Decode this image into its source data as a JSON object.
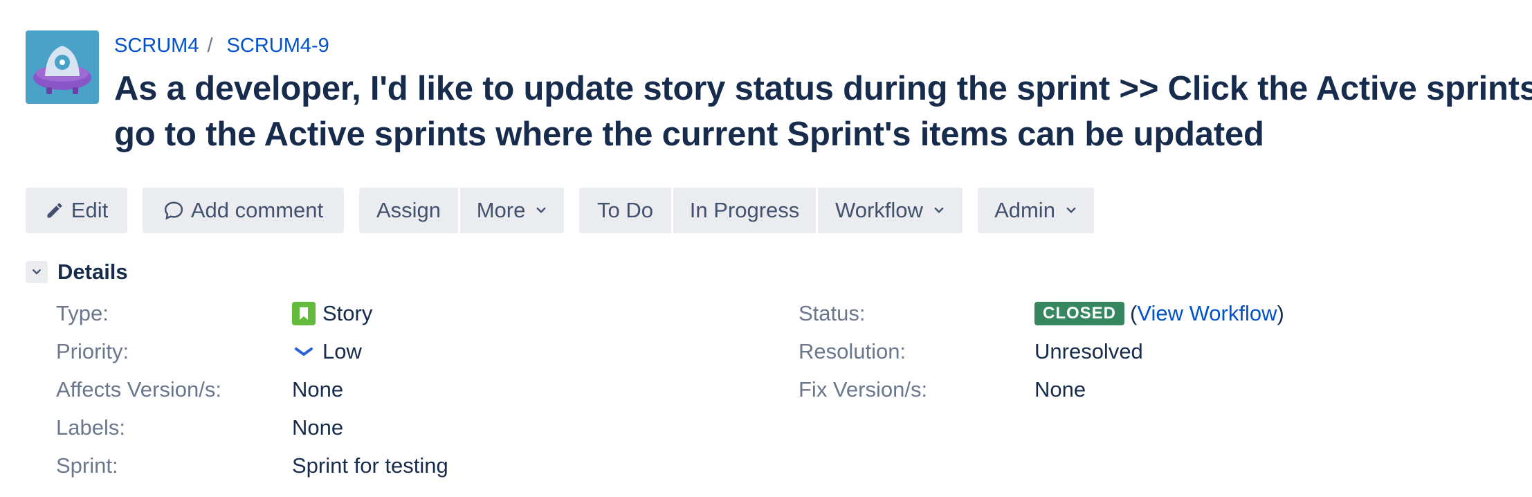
{
  "breadcrumb": {
    "project": "SCRUM4",
    "separator": "/",
    "issue_key": "SCRUM4-9"
  },
  "issue": {
    "title_line1": "As a developer, I'd like to update story status during the sprint >> Click the Active sprints link",
    "title_line2": "go to the Active sprints where the current Sprint's items can be updated"
  },
  "toolbar": {
    "edit": "Edit",
    "add_comment": "Add comment",
    "assign": "Assign",
    "more": "More",
    "to_do": "To Do",
    "in_progress": "In Progress",
    "workflow": "Workflow",
    "admin": "Admin"
  },
  "details": {
    "title": "Details",
    "type_label": "Type:",
    "type_value": "Story",
    "priority_label": "Priority:",
    "priority_value": "Low",
    "affects_label": "Affects Version/s:",
    "affects_value": "None",
    "labels_label": "Labels:",
    "labels_value": "None",
    "sprint_label": "Sprint:",
    "sprint_value": "Sprint for testing",
    "status_label": "Status:",
    "status_value": "CLOSED",
    "view_workflow_open": "(",
    "view_workflow": "View Workflow",
    "view_workflow_close": ")",
    "resolution_label": "Resolution:",
    "resolution_value": "Unresolved",
    "fix_label": "Fix Version/s:",
    "fix_value": "None"
  },
  "colors": {
    "link": "#0052cc",
    "status_closed": "#36875f",
    "story_icon": "#63ba3c",
    "priority_low": "#2a62d9",
    "avatar_bg": "#4aa2c8"
  },
  "icons": {
    "edit": "pencil-icon",
    "comment": "speech-bubble-icon",
    "dropdown": "chevron-down-icon",
    "type": "story-icon",
    "priority": "priority-low-icon"
  }
}
